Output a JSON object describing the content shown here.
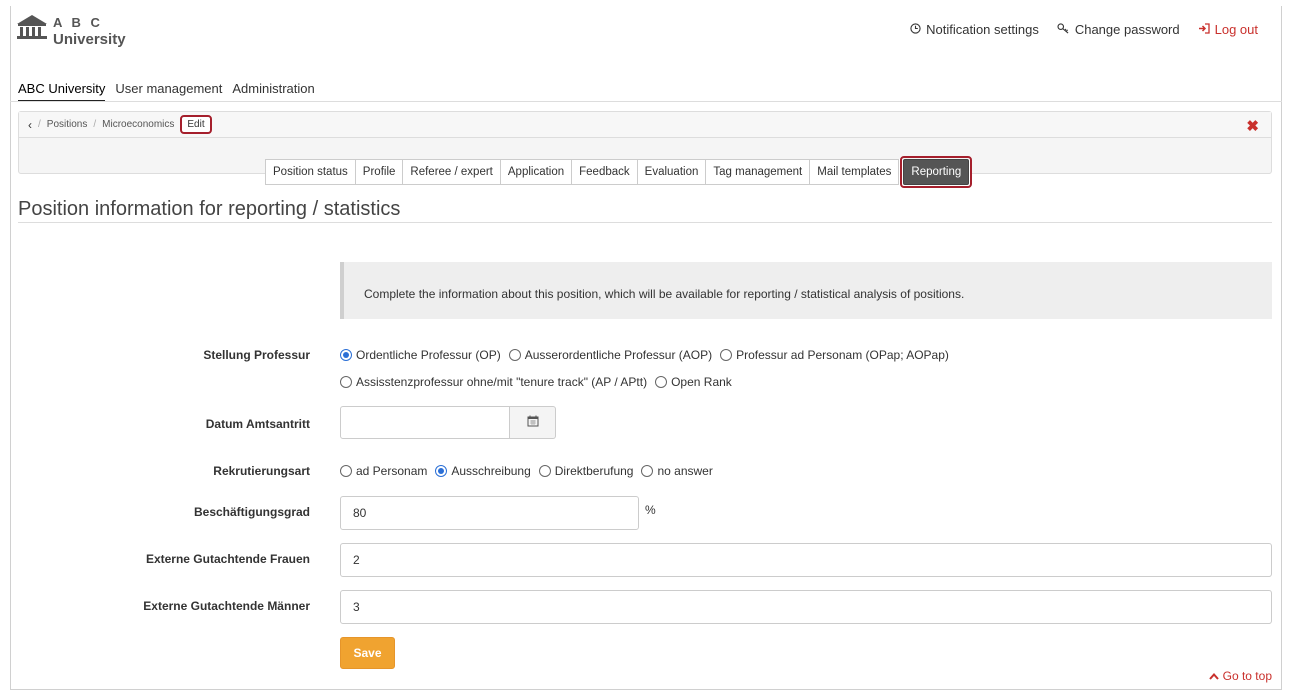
{
  "header": {
    "logo_top": "A B C",
    "logo_bottom": "University",
    "links": [
      {
        "icon": "clock-icon",
        "label": "Notification settings"
      },
      {
        "icon": "key-icon",
        "label": "Change password"
      },
      {
        "icon": "logout-icon",
        "label": "Log out"
      }
    ],
    "nav": [
      "ABC University",
      "User management",
      "Administration"
    ]
  },
  "breadcrumb": {
    "back": "‹",
    "items": [
      "Positions",
      "Microeconomics"
    ],
    "edit": "Edit",
    "close": "✖"
  },
  "tabs": [
    "Position status",
    "Profile",
    "Referee / expert",
    "Application",
    "Feedback",
    "Evaluation",
    "Tag management",
    "Mail templates"
  ],
  "active_tab": "Reporting",
  "page_title": "Position information for reporting / statistics",
  "info_text": "Complete the information about this position, which will be available for reporting / statistical analysis of positions.",
  "form": {
    "stellung_label": "Stellung Professur",
    "stellung_options": [
      {
        "label": "Ordentliche Professur (OP)",
        "selected": true
      },
      {
        "label": "Ausserordentliche Professur (AOP)",
        "selected": false
      },
      {
        "label": "Professur ad Personam (OPap; AOPap)",
        "selected": false
      },
      {
        "label": "Assisstenzprofessur ohne/mit \"tenure track\" (AP / APtt)",
        "selected": false
      },
      {
        "label": "Open Rank",
        "selected": false
      }
    ],
    "datum_label": "Datum Amtsantritt",
    "datum_value": "",
    "rekrut_label": "Rekrutierungsart",
    "rekrut_options": [
      {
        "label": "ad Personam",
        "selected": false
      },
      {
        "label": "Ausschreibung",
        "selected": true
      },
      {
        "label": "Direktberufung",
        "selected": false
      },
      {
        "label": "no answer",
        "selected": false
      }
    ],
    "besch_label": "Beschäftigungsgrad",
    "besch_value": "80",
    "besch_unit": "%",
    "frauen_label": "Externe Gutachtende Frauen",
    "frauen_value": "2",
    "maenner_label": "Externe Gutachtende Männer",
    "maenner_value": "3",
    "save_label": "Save"
  },
  "go_top": "Go to top"
}
